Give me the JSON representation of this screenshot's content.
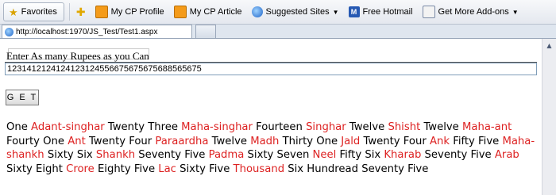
{
  "favorites_bar": {
    "favorites_label": "Favorites",
    "items": [
      {
        "label": "My CP Profile",
        "icon": "cp-icon"
      },
      {
        "label": "My CP Article",
        "icon": "cp-icon"
      },
      {
        "label": "Suggested Sites",
        "icon": "ie-icon",
        "dropdown": true
      },
      {
        "label": "Free Hotmail",
        "icon": "msn-icon"
      },
      {
        "label": "Get More Add-ons",
        "icon": "addon-icon",
        "dropdown": true
      }
    ]
  },
  "tab": {
    "url": "http://localhost:1970/JS_Test/Test1.aspx"
  },
  "page": {
    "prompt_label": "Enter As many Rupees as you Can",
    "amount_value": "1231412124124123124556675675675688565675",
    "get_button": "G E T",
    "result_segments": [
      {
        "text": "One ",
        "unit": false
      },
      {
        "text": "Adant-singhar",
        "unit": true
      },
      {
        "text": " Twenty Three ",
        "unit": false
      },
      {
        "text": "Maha-singhar",
        "unit": true
      },
      {
        "text": " Fourteen ",
        "unit": false
      },
      {
        "text": "Singhar",
        "unit": true
      },
      {
        "text": " Twelve ",
        "unit": false
      },
      {
        "text": "Shisht",
        "unit": true
      },
      {
        "text": " Twelve ",
        "unit": false
      },
      {
        "text": "Maha-ant",
        "unit": true
      },
      {
        "text": " Fourty One ",
        "unit": false
      },
      {
        "text": "Ant",
        "unit": true
      },
      {
        "text": " Twenty Four ",
        "unit": false
      },
      {
        "text": "Paraardha",
        "unit": true
      },
      {
        "text": " Twelve ",
        "unit": false
      },
      {
        "text": "Madh",
        "unit": true
      },
      {
        "text": " Thirty One ",
        "unit": false
      },
      {
        "text": "Jald",
        "unit": true
      },
      {
        "text": " Twenty Four ",
        "unit": false
      },
      {
        "text": "Ank",
        "unit": true
      },
      {
        "text": " Fifty Five ",
        "unit": false
      },
      {
        "text": "Maha-shankh",
        "unit": true
      },
      {
        "text": " Sixty Six ",
        "unit": false
      },
      {
        "text": "Shankh",
        "unit": true
      },
      {
        "text": " Seventy Five ",
        "unit": false
      },
      {
        "text": "Padma",
        "unit": true
      },
      {
        "text": " Sixty Seven ",
        "unit": false
      },
      {
        "text": "Neel",
        "unit": true
      },
      {
        "text": " Fifty Six ",
        "unit": false
      },
      {
        "text": "Kharab",
        "unit": true
      },
      {
        "text": " Seventy Five ",
        "unit": false
      },
      {
        "text": "Arab",
        "unit": true
      },
      {
        "text": " Sixty Eight ",
        "unit": false
      },
      {
        "text": "Crore",
        "unit": true
      },
      {
        "text": " Eighty Five ",
        "unit": false
      },
      {
        "text": "Lac",
        "unit": true
      },
      {
        "text": " Sixty Five ",
        "unit": false
      },
      {
        "text": "Thousand",
        "unit": true
      },
      {
        "text": " Six Hundread Seventy Five",
        "unit": false
      }
    ]
  },
  "colors": {
    "unit_red": "#dd2222"
  }
}
